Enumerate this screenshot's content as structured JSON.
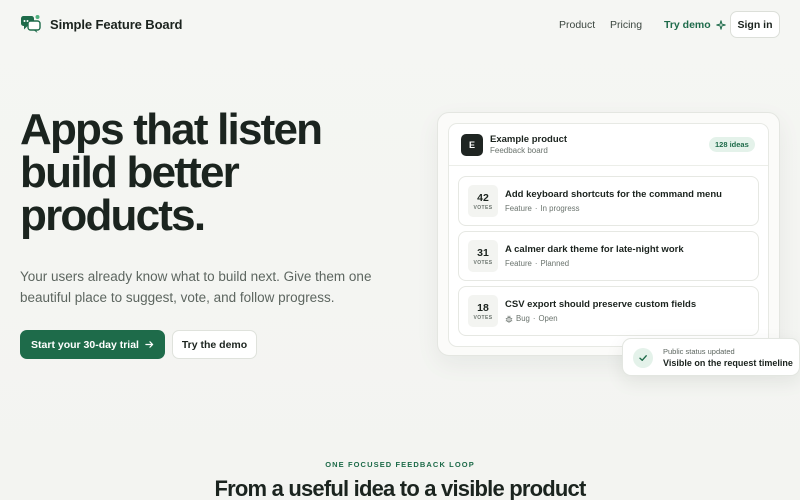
{
  "header": {
    "brand": "Simple Feature Board",
    "nav": {
      "product": "Product",
      "pricing": "Pricing",
      "try_demo": "Try demo",
      "sign_in": "Sign in"
    }
  },
  "hero": {
    "title": "Apps that listen build better products.",
    "subtitle": "Your users already know what to build next. Give them one beautiful place to suggest, vote, and follow progress.",
    "primary_cta": "Start your 30-day trial",
    "secondary_cta": "Try the demo"
  },
  "board": {
    "avatar_letter": "E",
    "product_name": "Example product",
    "product_subtitle": "Feedback board",
    "ideas_count": "128 ideas",
    "ideas": [
      {
        "votes": "42",
        "votes_label": "VOTES",
        "title": "Add keyboard shortcuts for the command menu",
        "category": "Feature",
        "status": "In progress"
      },
      {
        "votes": "31",
        "votes_label": "VOTES",
        "title": "A calmer dark theme for late-night work",
        "category": "Feature",
        "status": "Planned"
      },
      {
        "votes": "18",
        "votes_label": "VOTES",
        "title": "CSV export should preserve custom fields",
        "category": "Bug",
        "status": "Open"
      }
    ]
  },
  "toast": {
    "title": "Public status updated",
    "message": "Visible on the request timeline"
  },
  "section": {
    "eyebrow": "ONE FOCUSED FEEDBACK LOOP",
    "title": "From a useful idea to a visible product"
  },
  "colors": {
    "accent": "#1e6b4a",
    "accent_soft": "#e4f2ea",
    "text": "#1b231e",
    "background": "#f4f5f2"
  },
  "icons": {
    "logo": "chat-bubbles-icon",
    "try_demo": "sparkle-icon",
    "primary_cta": "arrow-right-icon",
    "bug": "bug-icon",
    "toast": "check-icon"
  }
}
